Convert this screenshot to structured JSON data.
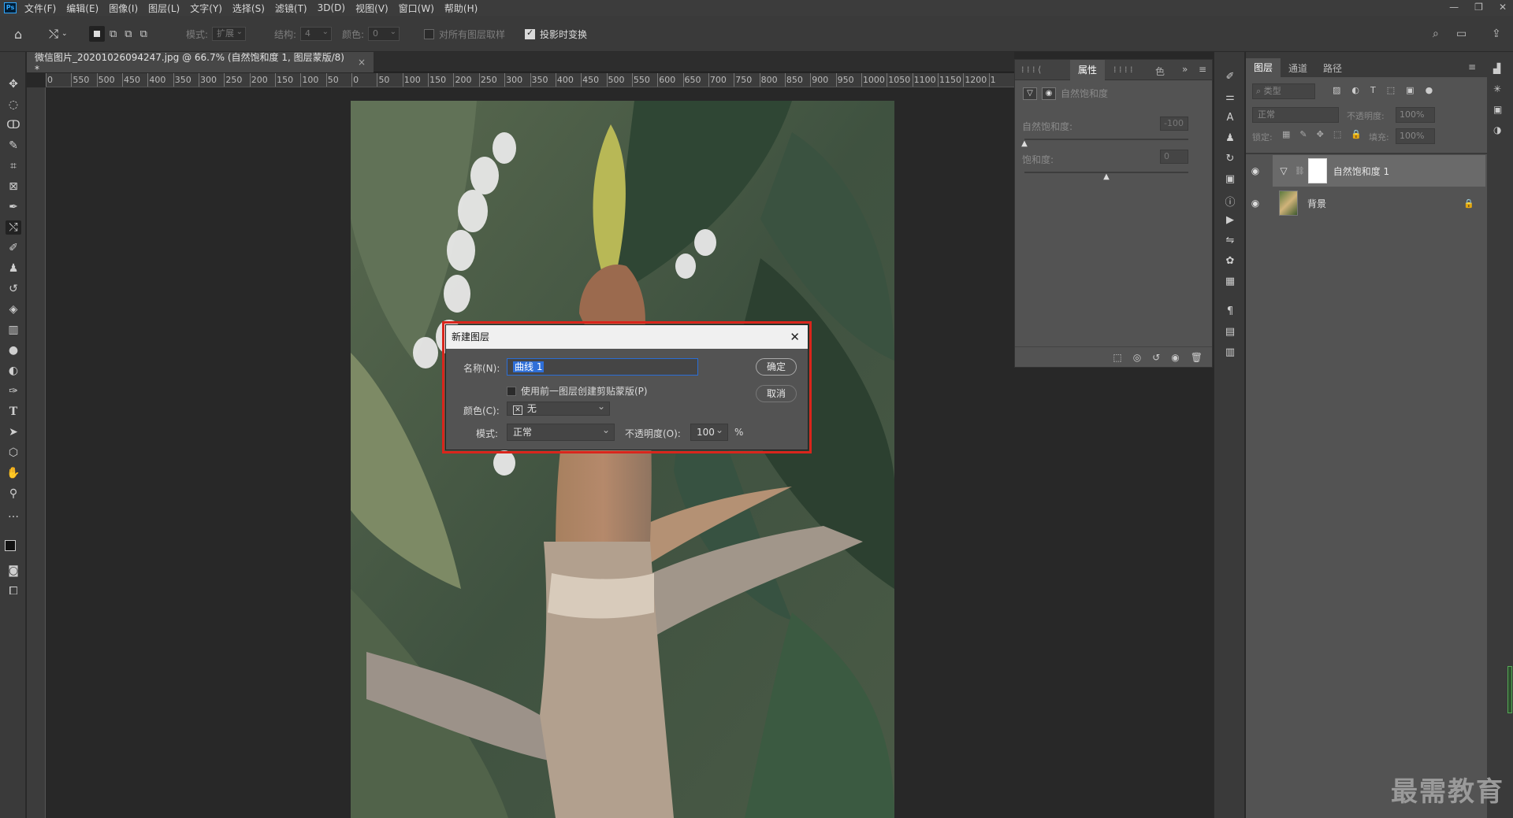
{
  "menu": {
    "items": [
      "文件(F)",
      "编辑(E)",
      "图像(I)",
      "图层(L)",
      "文字(Y)",
      "选择(S)",
      "滤镜(T)",
      "3D(D)",
      "视图(V)",
      "窗口(W)",
      "帮助(H)"
    ]
  },
  "options": {
    "mode_label": "模式:",
    "mode_value": "扩展",
    "structure_label": "结构:",
    "structure_value": "4",
    "color_label": "颜色:",
    "color_value": "0",
    "sample_all": "对所有图层取样",
    "transform_on_drop": "投影时变换"
  },
  "document": {
    "tab_title": "微信图片_20201026094247.jpg @ 66.7% (自然饱和度 1, 图层蒙版/8) *",
    "ruler_ticks": [
      "0",
      "550",
      "500",
      "450",
      "400",
      "350",
      "300",
      "250",
      "200",
      "150",
      "100",
      "50",
      "0",
      "50",
      "100",
      "150",
      "200",
      "250",
      "300",
      "350",
      "400",
      "450",
      "500",
      "550",
      "600",
      "650",
      "700",
      "750",
      "800",
      "850",
      "900",
      "950",
      "1000",
      "1050",
      "1100",
      "1150",
      "1200",
      "1"
    ]
  },
  "properties": {
    "tab_label": "属性",
    "color_tab": "色",
    "panel_title": "自然饱和度",
    "vibrance_label": "自然饱和度:",
    "vibrance_value": "-100",
    "saturation_label": "饱和度:",
    "saturation_value": "0",
    "vibrance_level": -100,
    "saturation_level": 0
  },
  "layers_panel": {
    "tabs": [
      "图层",
      "通道",
      "路径"
    ],
    "filter_placeholder": "类型",
    "blend_mode": "正常",
    "opacity_label": "不透明度:",
    "opacity_value": "100%",
    "lock_label": "锁定:",
    "fill_label": "填充:",
    "fill_value": "100%",
    "layers": [
      {
        "name": "自然饱和度 1"
      },
      {
        "name": "背景"
      }
    ]
  },
  "dialog": {
    "title": "新建图层",
    "name_label": "名称(N):",
    "name_value": "曲线 1",
    "ok": "确定",
    "cancel": "取消",
    "clip_label": "使用前一图层创建剪贴蒙版(P)",
    "color_label": "颜色(C):",
    "color_value": "无",
    "mode_label": "模式:",
    "mode_value": "正常",
    "opacity_label": "不透明度(O):",
    "opacity_value": "100",
    "percent": "%"
  },
  "watermark": "最需教育",
  "icons": [
    "ps-logo",
    "home-icon",
    "magic-wand-icon",
    "move-icon",
    "marquee-icon",
    "lasso-icon",
    "quick-select-icon",
    "crop-icon",
    "frame-icon",
    "eyedropper-icon",
    "content-aware-move-icon",
    "brush-icon",
    "stamp-icon",
    "history-brush-icon",
    "eraser-icon",
    "gradient-icon",
    "blur-icon",
    "dodge-icon",
    "pen-icon",
    "type-icon",
    "path-select-icon",
    "shape-icon",
    "hand-icon",
    "zoom-icon",
    "more-icon",
    "eye-icon",
    "lock-icon",
    "trash-icon",
    "close-icon",
    "search-icon"
  ]
}
